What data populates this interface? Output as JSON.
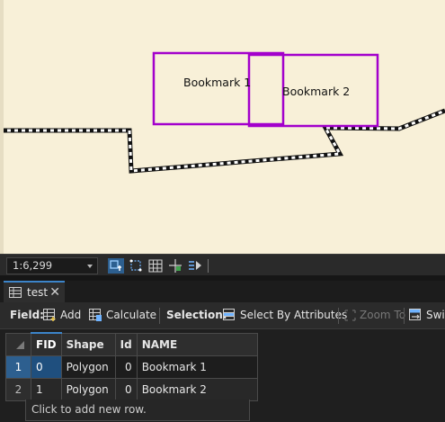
{
  "map": {
    "bookmarks": [
      {
        "label": "Bookmark 1"
      },
      {
        "label": "Bookmark 2"
      }
    ]
  },
  "statusbar": {
    "scale": "1:6,299"
  },
  "table_tab": {
    "label": "test",
    "close_glyph": "✕"
  },
  "toolbar": {
    "field_label": "Field:",
    "add_label": "Add",
    "calculate_label": "Calculate",
    "selection_label": "Selection:",
    "select_by_attributes_label": "Select By Attributes",
    "zoom_to_label": "Zoom To",
    "switch_label": "Swit"
  },
  "attribute_table": {
    "columns": [
      "FID",
      "Shape",
      "Id",
      "NAME"
    ],
    "rows": [
      {
        "row_num": "1",
        "FID": "0",
        "Shape": "Polygon",
        "Id": "0",
        "NAME": "Bookmark 1"
      },
      {
        "row_num": "2",
        "FID": "1",
        "Shape": "Polygon",
        "Id": "0",
        "NAME": "Bookmark 2"
      }
    ],
    "add_row_text": "Click to add new row."
  },
  "colors": {
    "map_background": "#f8f0d8",
    "bookmark_outline": "#a300cc",
    "accent": "#3c84c9"
  }
}
